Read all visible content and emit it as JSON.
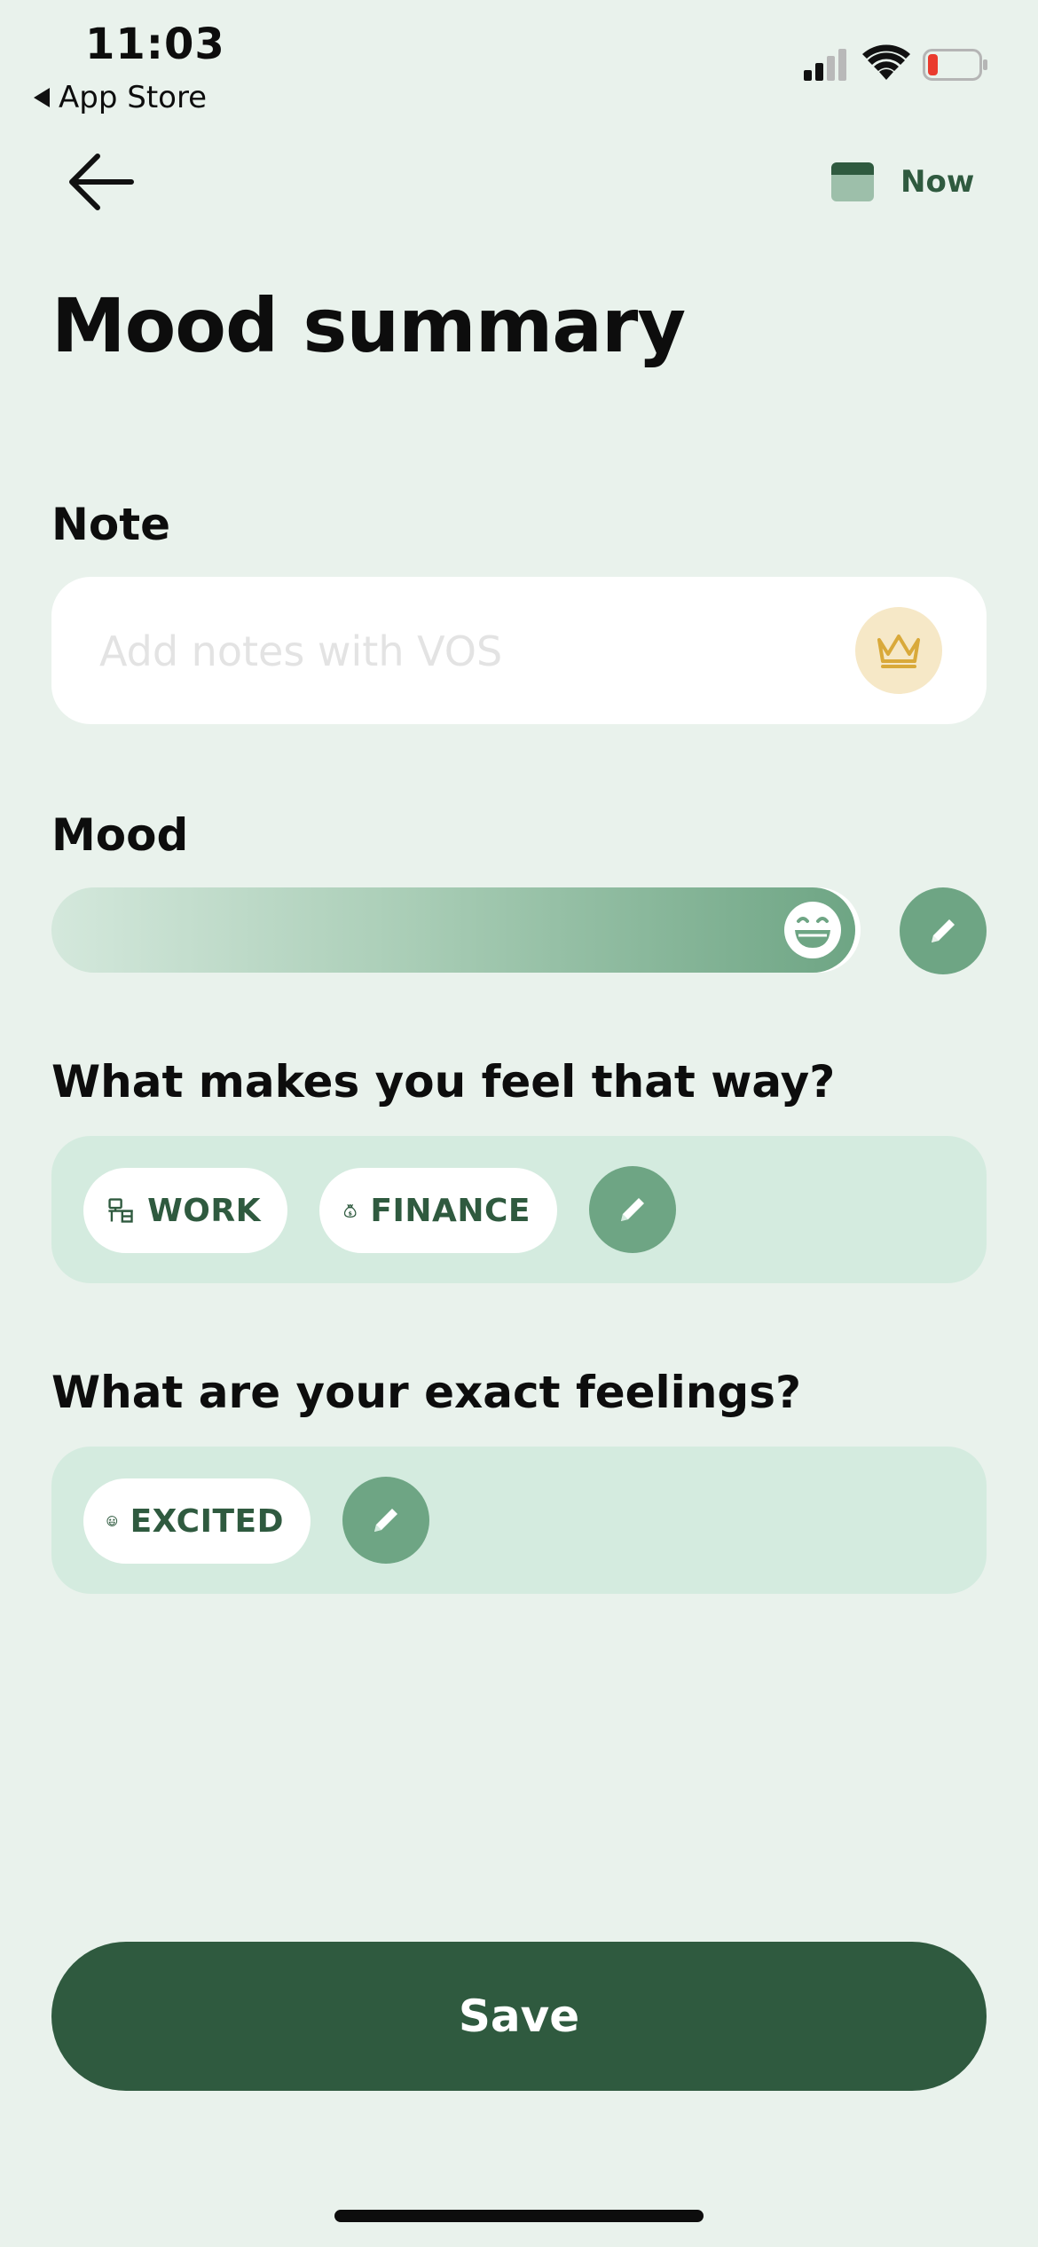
{
  "status_bar": {
    "time": "11:03",
    "back_app": "App Store",
    "icons": [
      "cellular-signal-icon",
      "wifi-icon",
      "battery-low-icon"
    ]
  },
  "nav": {
    "back_icon": "arrow-left-icon",
    "date_icon": "calendar-icon",
    "date_label": "Now"
  },
  "title": "Mood summary",
  "note": {
    "label": "Note",
    "value": "",
    "placeholder": "Add notes with VOS",
    "premium_icon": "crown-icon"
  },
  "mood": {
    "label": "Mood",
    "level": 1.0,
    "thumb_icon": "laughing-face-icon",
    "edit_icon": "pencil-icon"
  },
  "reasons": {
    "label": "What makes you feel that way?",
    "chips": [
      {
        "label": "WORK",
        "icon": "desk-icon"
      },
      {
        "label": "FINANCE",
        "icon": "money-bag-icon"
      }
    ],
    "edit_icon": "pencil-icon"
  },
  "feelings": {
    "label": "What are your exact feelings?",
    "chips": [
      {
        "label": "EXCITED",
        "icon": "star-eyes-face-icon"
      }
    ],
    "edit_icon": "pencil-icon"
  },
  "save_label": "Save",
  "colors": {
    "background": "#e9f2ec",
    "primary": "#2f5a3f",
    "accent": "#6ea584",
    "panel": "#d4ebdf",
    "premium": "#d9a93a"
  }
}
